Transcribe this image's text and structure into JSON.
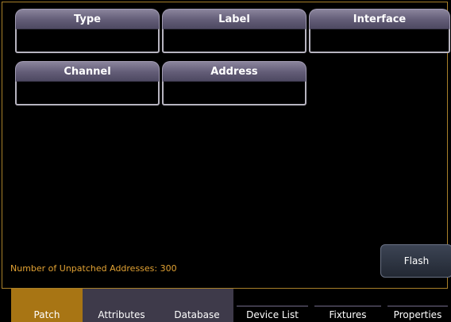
{
  "fields": {
    "type": {
      "label": "Type",
      "value": ""
    },
    "label": {
      "label": "Label",
      "value": ""
    },
    "interface": {
      "label": "Interface",
      "value": ""
    },
    "channel": {
      "label": "Channel",
      "value": ""
    },
    "address": {
      "label": "Address",
      "value": ""
    }
  },
  "status": {
    "unpatched": "Number of Unpatched Addresses: 300"
  },
  "buttons": {
    "flash": "Flash"
  },
  "tabs": [
    {
      "label": "Patch",
      "active": true
    },
    {
      "label": "Attributes",
      "active": false
    },
    {
      "label": "Database",
      "active": false
    },
    {
      "label": "Device List",
      "active": false
    },
    {
      "label": "Fixtures",
      "active": false
    },
    {
      "label": "Properties",
      "active": false
    }
  ],
  "colors": {
    "accent": "#a87514",
    "status_text": "#e2a233",
    "tab_shaded": "#3e3a4a",
    "border": "#a8802a"
  }
}
